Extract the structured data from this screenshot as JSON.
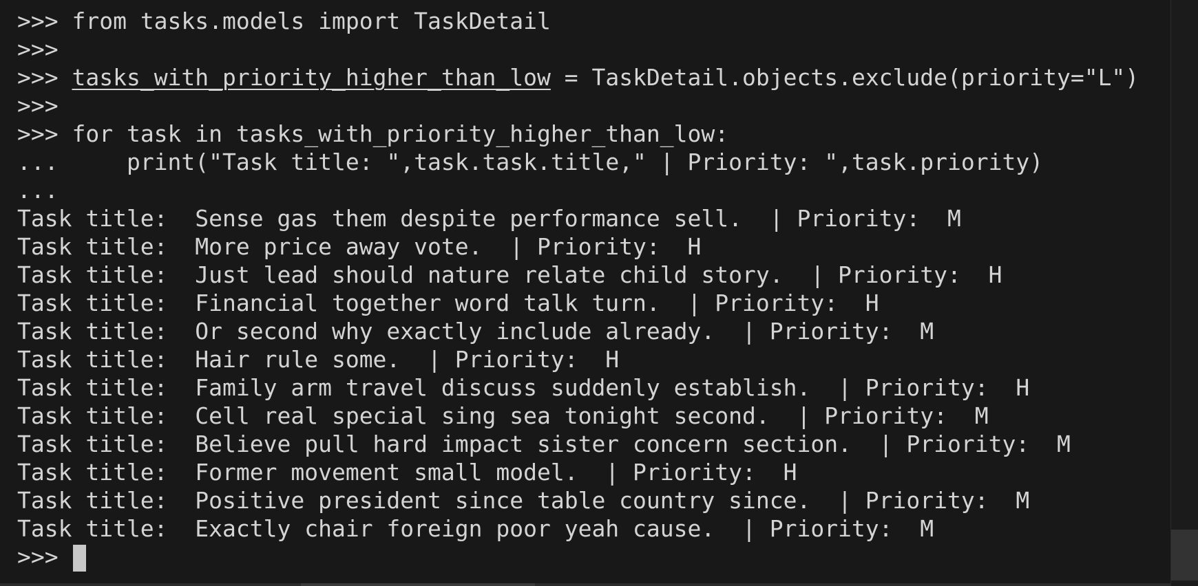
{
  "terminal": {
    "prompt": ">>>",
    "continuation": "...",
    "lines": [
      {
        "prefix": ">>>",
        "text": ""
      },
      {
        "prefix": ">>>",
        "text": " from tasks.models import TaskDetail"
      },
      {
        "prefix": ">>>",
        "text": ""
      },
      {
        "prefix": ">>>",
        "underlined": "tasks_with_priority_higher_than_low",
        "text": " = TaskDetail.objects.exclude(priority=\"L\")"
      },
      {
        "prefix": ">>>",
        "text": ""
      },
      {
        "prefix": ">>>",
        "text": " for task in tasks_with_priority_higher_than_low:"
      },
      {
        "prefix": "...",
        "text": "     print(\"Task title: \",task.task.title,\" | Priority: \",task.priority)"
      },
      {
        "prefix": "...",
        "text": ""
      }
    ],
    "output": [
      "Task title:  Sense gas them despite performance sell.  | Priority:  M",
      "Task title:  More price away vote.  | Priority:  H",
      "Task title:  Just lead should nature relate child story.  | Priority:  H",
      "Task title:  Financial together word talk turn.  | Priority:  H",
      "Task title:  Or second why exactly include already.  | Priority:  M",
      "Task title:  Hair rule some.  | Priority:  H",
      "Task title:  Family arm travel discuss suddenly establish.  | Priority:  H",
      "Task title:  Cell real special sing sea tonight second.  | Priority:  M",
      "Task title:  Believe pull hard impact sister concern section.  | Priority:  M",
      "Task title:  Former movement small model.  | Priority:  H",
      "Task title:  Positive president since table country since.  | Priority:  M",
      "Task title:  Exactly chair foreign poor yeah cause.  | Priority:  M"
    ],
    "final_prompt": ">>> "
  },
  "colors": {
    "background": "#181818",
    "text": "#d4d4d4",
    "cursor": "#c8c8c8",
    "scroll_marker_blue": "#1f8ad2",
    "scroll_marker_gray": "#5a5a5a"
  }
}
